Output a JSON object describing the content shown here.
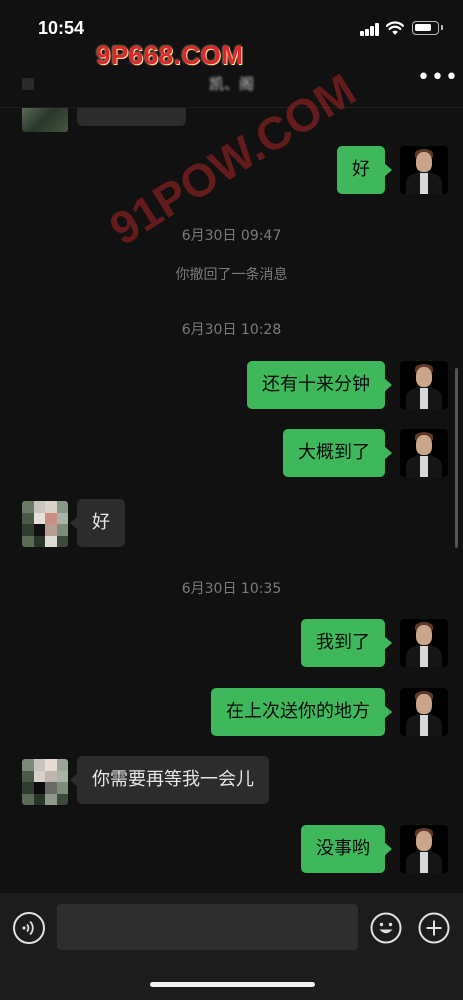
{
  "status_bar": {
    "time": "10:54"
  },
  "watermark": {
    "top": "9P668.COM",
    "diagonal": "91POW.COM"
  },
  "nav": {
    "title": "凯、阁",
    "more_label": "•••"
  },
  "messages": [
    {
      "from": "me",
      "text": "好"
    },
    {
      "type": "time",
      "text": "6月30日 09:47"
    },
    {
      "type": "system",
      "text": "你撤回了一条消息"
    },
    {
      "type": "time",
      "text": "6月30日 10:28"
    },
    {
      "from": "me",
      "text": "还有十来分钟"
    },
    {
      "from": "me",
      "text": "大概到了"
    },
    {
      "from": "other",
      "text": "好"
    },
    {
      "type": "time",
      "text": "6月30日 10:35"
    },
    {
      "from": "me",
      "text": "我到了"
    },
    {
      "from": "me",
      "text": "在上次送你的地方"
    },
    {
      "from": "other",
      "text": "你需要再等我一会儿"
    },
    {
      "from": "me",
      "text": "没事哟"
    }
  ],
  "input_bar": {
    "placeholder": "",
    "icons": [
      "voice-icon",
      "emoji-icon",
      "plus-icon"
    ]
  },
  "colors": {
    "my_bubble": "#3fb85b",
    "other_bubble": "#2c2c2c",
    "background": "#111111",
    "input_bar": "#1c1c1c"
  }
}
